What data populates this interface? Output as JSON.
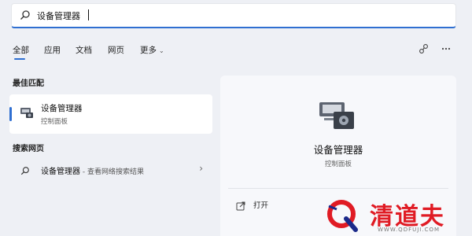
{
  "search": {
    "query": "设备管理器"
  },
  "tabs": [
    {
      "label": "全部"
    },
    {
      "label": "应用"
    },
    {
      "label": "文档"
    },
    {
      "label": "网页"
    },
    {
      "label": "更多"
    }
  ],
  "best_match": {
    "section_title": "最佳匹配",
    "name": "设备管理器",
    "subtitle": "控制面板"
  },
  "web_search": {
    "section_title": "搜索网页",
    "query": "设备管理器",
    "suffix": " - 查看网络搜索结果"
  },
  "detail": {
    "title": "设备管理器",
    "subtitle": "控制面板",
    "actions": [
      {
        "label": "打开"
      }
    ]
  },
  "watermark": {
    "brand_text": "清道夫",
    "url": "WWW.QDFUJI.COM"
  },
  "colors": {
    "accent": "#2f6fd1",
    "watermark_red": "#e01b24"
  }
}
